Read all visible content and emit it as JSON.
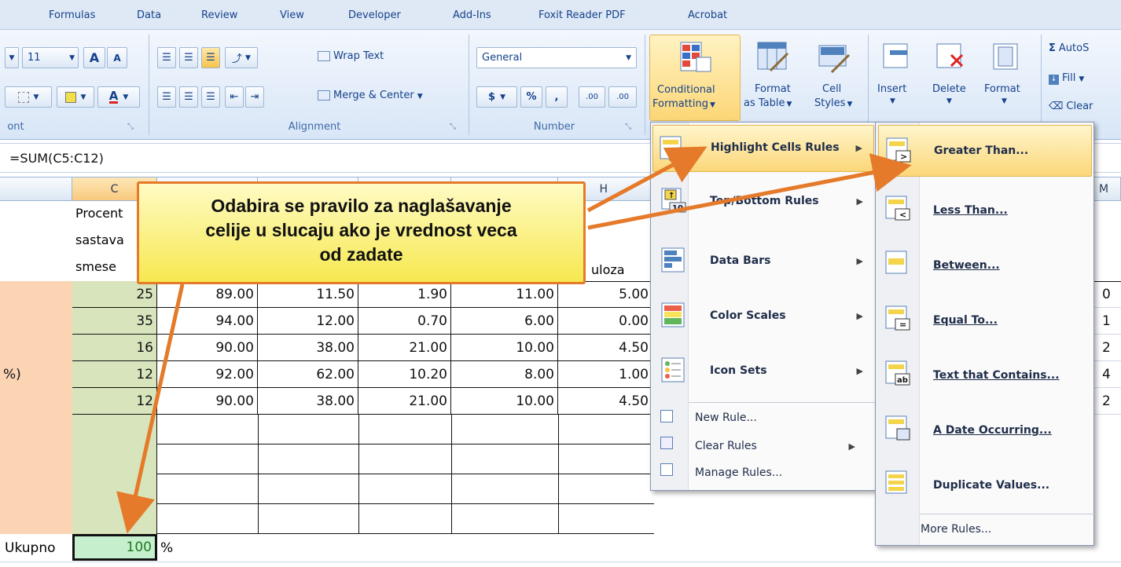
{
  "tabs": [
    "Formulas",
    "Data",
    "Review",
    "View",
    "Developer",
    "Add-Ins",
    "Foxit Reader PDF",
    "Acrobat"
  ],
  "ribbon": {
    "font_size": "11",
    "font_group_label": "ont",
    "alignment_label": "Alignment",
    "number_label": "Number",
    "wrap_text": "Wrap Text",
    "merge_center": "Merge & Center",
    "number_format": "General",
    "currency_symbol": "$",
    "percent_symbol": "%",
    "comma_symbol": ",",
    "inc_decimal": ".00",
    "conditional_formatting_line1": "Conditional",
    "conditional_formatting_line2": "Formatting",
    "format_as_table_line1": "Format",
    "format_as_table_line2": "as Table",
    "cell_styles_line1": "Cell",
    "cell_styles_line2": "Styles",
    "insert": "Insert",
    "delete": "Delete",
    "format": "Format",
    "autosum": "AutoS",
    "fill": "Fill",
    "clear": "Clear"
  },
  "formula": "=SUM(C5:C12)",
  "columns": {
    "c": "C",
    "h": "H",
    "m": "M"
  },
  "header_cells": {
    "c1": "Procent",
    "c2": "sastava",
    "c3": "smese",
    "h": "uloza"
  },
  "rows": [
    {
      "c": "25",
      "d": "89.00",
      "e": "11.50",
      "f": "1.90",
      "g": "11.00",
      "h": "5.00",
      "m": "0"
    },
    {
      "c": "35",
      "d": "94.00",
      "e": "12.00",
      "f": "0.70",
      "g": "6.00",
      "h": "0.00",
      "m": "1"
    },
    {
      "c": "16",
      "d": "90.00",
      "e": "38.00",
      "f": "21.00",
      "g": "10.00",
      "h": "4.50",
      "m": "2"
    },
    {
      "c": "12",
      "d": "92.00",
      "e": "62.00",
      "f": "10.20",
      "g": "8.00",
      "h": "1.00",
      "m": "4",
      "a": "%)"
    },
    {
      "c": "12",
      "d": "90.00",
      "e": "38.00",
      "f": "21.00",
      "g": "10.00",
      "h": "4.50",
      "m": "2"
    }
  ],
  "total": {
    "label": "Ukupno",
    "value": "100",
    "suffix": "%"
  },
  "callout": {
    "line1": "Odabira se pravilo za naglašavanje",
    "line2": "celije u slucaju ako je vrednost veca",
    "line3": "od zadate"
  },
  "menu1": {
    "highlight": "Highlight Cells Rules",
    "topbottom": "Top/Bottom Rules",
    "databars": "Data Bars",
    "colorscales": "Color Scales",
    "iconsets": "Icon Sets",
    "newrule": "New Rule...",
    "clearrules": "Clear Rules",
    "managerules": "Manage Rules..."
  },
  "menu2": {
    "greater": "Greater Than...",
    "less": "Less Than...",
    "between": "Between...",
    "equal": "Equal To...",
    "text": "Text that Contains...",
    "date": "A Date Occurring...",
    "duplicate": "Duplicate Values...",
    "more": "More Rules..."
  },
  "colors": {
    "accent_orange": "#e47a2a",
    "highlight": "#fbd779",
    "total_fill": "#c6efce",
    "row_header_fill": "#fbd4b4"
  }
}
